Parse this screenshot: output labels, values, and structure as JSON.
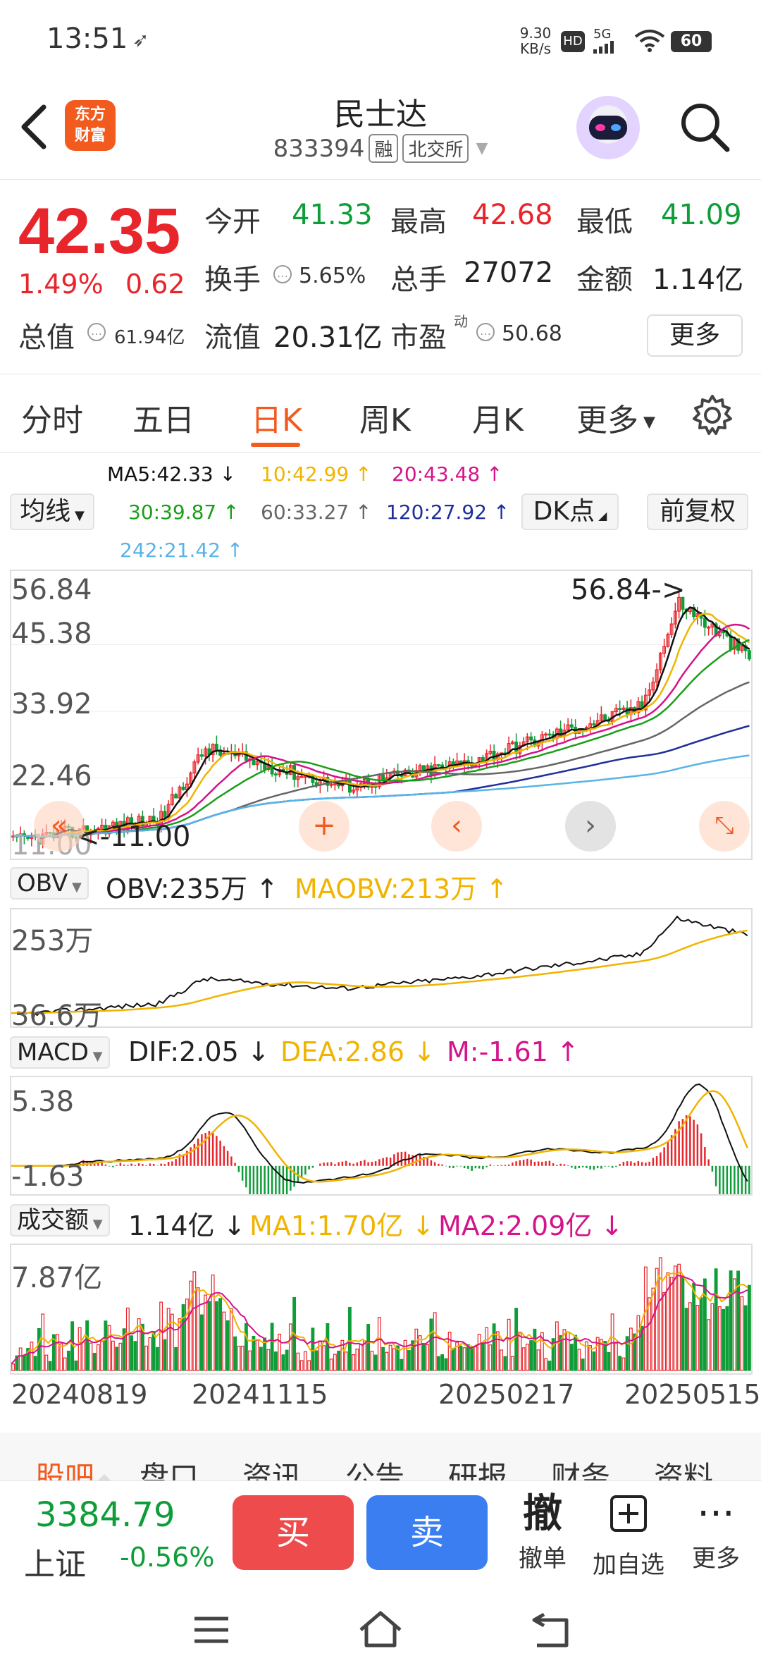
{
  "status_bar": {
    "time": "13:51",
    "speed_value": "9.30",
    "speed_unit": "KB/s",
    "hd": "HD",
    "network": "5G",
    "battery": "60"
  },
  "header": {
    "logo_line1": "东方",
    "logo_line2": "财富",
    "stock_name": "民士达",
    "stock_code": "833394",
    "tag_margin": "融",
    "tag_exchange": "北交所"
  },
  "quote": {
    "price": "42.35",
    "change_pct": "1.49%",
    "change_amt": "0.62",
    "open_label": "今开",
    "open_value": "41.33",
    "high_label": "最高",
    "high_value": "42.68",
    "low_label": "最低",
    "low_value": "41.09",
    "turnover_label": "换手",
    "turnover_value": "5.65%",
    "volume_label": "总手",
    "volume_value": "27072",
    "amount_label": "金额",
    "amount_value": "1.14亿",
    "mktcap_label": "总值",
    "mktcap_value": "61.94亿",
    "float_label": "流值",
    "float_value": "20.31亿",
    "pe_label": "市盈",
    "pe_sup": "动",
    "pe_value": "50.68",
    "more_label": "更多"
  },
  "period_tabs": [
    "分时",
    "五日",
    "日K",
    "周K",
    "月K",
    "更多"
  ],
  "active_period": "日K",
  "ma": {
    "ma5": "MA5:42.33 ↓",
    "ma10": "10:42.99 ↑",
    "ma20": "20:43.48 ↑",
    "ma30": "30:39.87 ↑",
    "ma60": "60:33.27 ↑",
    "ma120": "120:27.92 ↑",
    "ma242": "242:21.42 ↑",
    "chip_ma": "均线",
    "chip_dk": "DK点",
    "chip_adjust": "前复权"
  },
  "colors": {
    "up": "#e8252b",
    "down": "#0f9d39",
    "ma5": "#111111",
    "ma10": "#f0b400",
    "ma20": "#d4148a",
    "ma30": "#1a9e1a",
    "ma60": "#666666",
    "ma120": "#1f2f9a",
    "ma242": "#58b4e8"
  },
  "kline": {
    "y_labels": [
      "56.84",
      "45.38",
      "33.92",
      "22.46",
      "11.00"
    ],
    "max_marker": "56.84->",
    "min_marker": "<-11.00"
  },
  "obv": {
    "chip": "OBV",
    "value": "OBV:235万 ↑",
    "ma_value": "MAOBV:213万 ↑",
    "y_top": "253万",
    "y_bottom": "36.6万"
  },
  "macd": {
    "chip": "MACD",
    "dif": "DIF:2.05 ↓",
    "dea": "DEA:2.86 ↓",
    "m": "M:-1.61 ↑",
    "y_top": "5.38",
    "y_bottom": "-1.63"
  },
  "volume": {
    "chip": "成交额",
    "value": "1.14亿 ↓",
    "ma1": "MA1:1.70亿 ↓",
    "ma2": "MA2:2.09亿 ↓",
    "y_top": "7.87亿"
  },
  "dates": [
    "20240819",
    "20241115",
    "20250217",
    "20250515"
  ],
  "bottom_tabs": [
    "股吧",
    "盘口",
    "资讯",
    "公告",
    "研报",
    "财务",
    "资料"
  ],
  "bottom_bar": {
    "index_value": "3384.79",
    "index_name": "上证",
    "index_change": "-0.56%",
    "buy": "买",
    "sell": "卖",
    "cancel_icon": "撤",
    "cancel": "撤单",
    "add_watch": "加自选",
    "more": "更多"
  },
  "chart_data": {
    "type": "line",
    "title": "",
    "ylim": [
      11.0,
      56.84
    ],
    "x": [
      "20240819",
      "20241115",
      "20250217",
      "20250515"
    ],
    "series": [
      {
        "name": "MA5",
        "values": [
          11.5,
          26.0,
          22.0,
          44.0
        ]
      },
      {
        "name": "MA242",
        "values": [
          11.0,
          12.5,
          17.0,
          21.42
        ]
      }
    ]
  }
}
